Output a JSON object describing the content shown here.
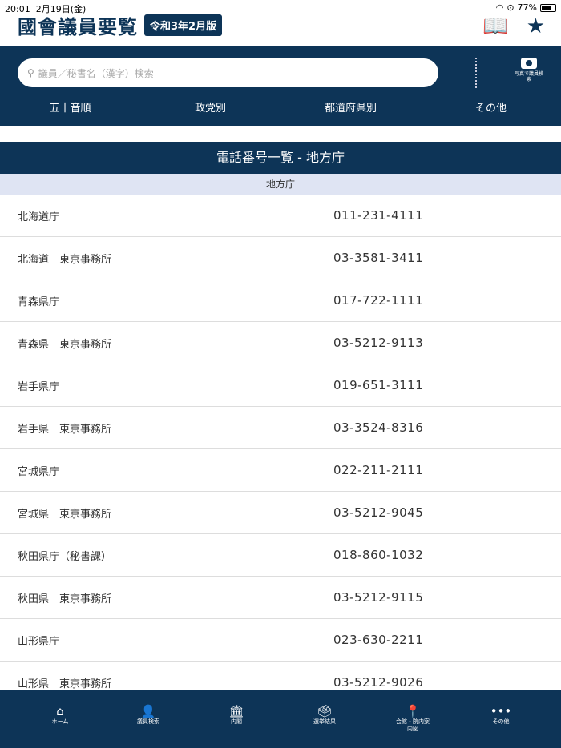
{
  "status": {
    "time": "20:01",
    "date": "2月19日(金)",
    "battery": "77%",
    "battery_level": 0.77
  },
  "header": {
    "title": "國會議員要覧",
    "edition": "令和3年2月版"
  },
  "search": {
    "placeholder": "議員／秘書名（漢字）検索",
    "photo_search": "写真で議員検索"
  },
  "tabs": [
    "五十音順",
    "政党別",
    "都道府県別",
    "その他"
  ],
  "section": {
    "title": "電話番号一覧 - 地方庁",
    "subheader": "地方庁"
  },
  "rows": [
    {
      "name": "北海道庁",
      "phone": "011-231-4111"
    },
    {
      "name": "北海道　東京事務所",
      "phone": "03-3581-3411"
    },
    {
      "name": "青森県庁",
      "phone": "017-722-1111"
    },
    {
      "name": "青森県　東京事務所",
      "phone": "03-5212-9113"
    },
    {
      "name": "岩手県庁",
      "phone": "019-651-3111"
    },
    {
      "name": "岩手県　東京事務所",
      "phone": "03-3524-8316"
    },
    {
      "name": "宮城県庁",
      "phone": "022-211-2111"
    },
    {
      "name": "宮城県　東京事務所",
      "phone": "03-5212-9045"
    },
    {
      "name": "秋田県庁（秘書課）",
      "phone": "018-860-1032"
    },
    {
      "name": "秋田県　東京事務所",
      "phone": "03-5212-9115"
    },
    {
      "name": "山形県庁",
      "phone": "023-630-2211"
    },
    {
      "name": "山形県　東京事務所",
      "phone": "03-5212-9026"
    }
  ],
  "bottom_nav": [
    {
      "label": "ホーム",
      "icon": "home-icon"
    },
    {
      "label": "議員検索",
      "icon": "person-icon"
    },
    {
      "label": "内閣",
      "icon": "diet-building-icon"
    },
    {
      "label": "選挙結果",
      "icon": "ballot-box-icon"
    },
    {
      "label": "会館・院内案内図",
      "icon": "map-pin-icon"
    },
    {
      "label": "その他",
      "icon": "more-icon"
    }
  ],
  "colors": {
    "primary": "#0d3457",
    "subheader": "#dfe4f3"
  }
}
